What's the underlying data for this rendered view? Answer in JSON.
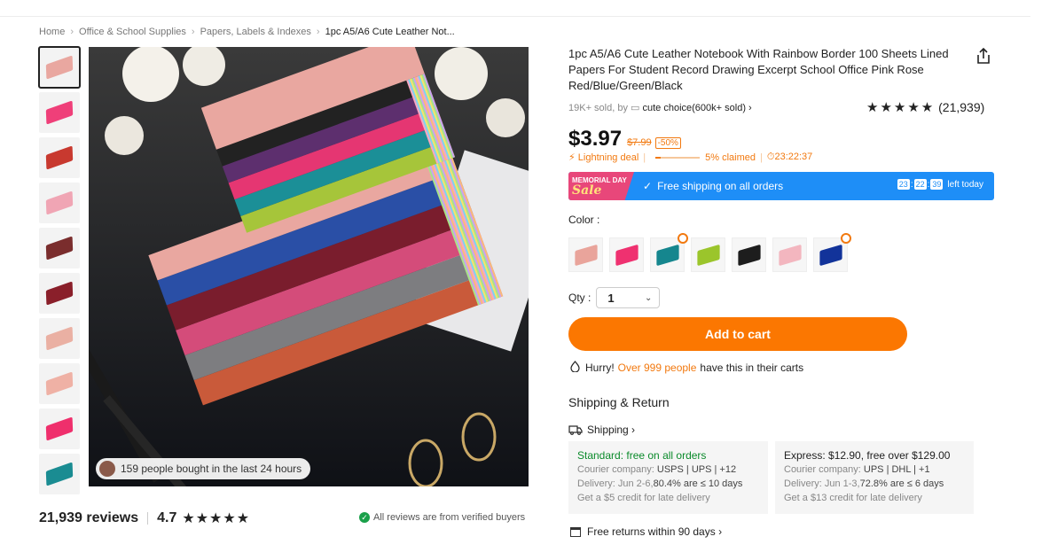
{
  "breadcrumb": [
    "Home",
    "Office & School Supplies",
    "Papers, Labels & Indexes",
    "1pc A5/A6 Cute Leather Not..."
  ],
  "thumbnails": [
    {
      "color": "#e9a7a0",
      "active": true
    },
    {
      "color": "#ef3f79"
    },
    {
      "color": "#c8392f"
    },
    {
      "color": "#f0a5b4"
    },
    {
      "color": "#7a2d2d"
    },
    {
      "color": "#8a1f2a"
    },
    {
      "color": "#eab0a3"
    },
    {
      "color": "#efb1a5"
    },
    {
      "color": "#ef2f6c"
    },
    {
      "color": "#1a8c92"
    }
  ],
  "main_image": {
    "overlay_text": "159 people bought in the last 24 hours"
  },
  "reviews_summary": {
    "count_text": "21,939 reviews",
    "score": "4.7",
    "stars": "★★★★★",
    "verified_text": "All reviews are from verified buyers"
  },
  "product": {
    "title": "1pc A5/A6 Cute Leather Notebook With Rainbow Border 100 Sheets Lined Papers For Student Record Drawing Excerpt School Office Pink Rose Red/Blue/Green/Black",
    "sold_prefix": "19K+ sold, by",
    "store_name": "cute choice(600k+ sold)",
    "store_chevron": "›",
    "rating_stars": "★★★★★",
    "rating_count": "(21,939)"
  },
  "price": {
    "current": "$3.97",
    "original": "$7.99",
    "discount": "-50%"
  },
  "lightning": {
    "label": "⚡ Lightning deal",
    "claimed": "5% claimed",
    "countdown": "⏱23:22:37"
  },
  "banner": {
    "tag_top": "MEMORIAL DAY",
    "tag_bottom": "Sale",
    "text": "Free shipping on all orders",
    "checkmark": "✓",
    "hh": "23",
    "mm": "22",
    "ss": "39",
    "suffix": "left today"
  },
  "color": {
    "label": "Color :",
    "swatches": [
      {
        "color": "#e9a49b",
        "badge": false
      },
      {
        "color": "#ef3170",
        "badge": false
      },
      {
        "color": "#15868e",
        "badge": true
      },
      {
        "color": "#9bc52b",
        "badge": false
      },
      {
        "color": "#1d1d1d",
        "badge": false
      },
      {
        "color": "#f3b6bf",
        "badge": false
      },
      {
        "color": "#12339a",
        "badge": true
      }
    ]
  },
  "qty": {
    "label": "Qty :",
    "value": "1",
    "chevron": "⌄"
  },
  "cart": {
    "label": "Add to cart"
  },
  "hurry": {
    "prefix": "Hurry!",
    "highlight": "Over 999 people",
    "suffix": "have this in their carts"
  },
  "shipping_return": {
    "title": "Shipping & Return",
    "shipping_link": "Shipping ›",
    "standard": {
      "title": "Standard: free on all orders",
      "courier_label": "Courier company:",
      "couriers": "USPS | UPS | +12",
      "delivery_prefix": "Delivery: Jun 2-6,",
      "delivery_stat": "80.4% are ≤ 10 days",
      "credit": "Get a $5 credit for late delivery"
    },
    "express": {
      "title": "Express: $12.90, free over $129.00",
      "courier_label": "Courier company:",
      "couriers": "UPS | DHL | +1",
      "delivery_prefix": "Delivery: Jun 1-3,",
      "delivery_stat": "72.8% are ≤ 6 days",
      "credit": "Get a $13 credit for late delivery"
    },
    "returns": "Free returns within 90 days ›"
  }
}
